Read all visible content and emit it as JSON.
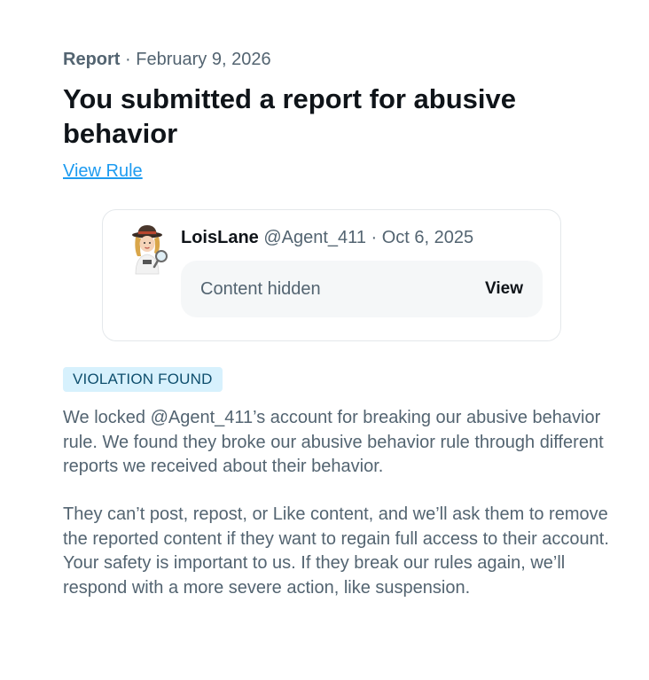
{
  "header": {
    "label": "Report",
    "separator": "·",
    "date": "February 9, 2026",
    "title": "You submitted a report for abusive behavior",
    "view_rule_link": "View Rule"
  },
  "reported_post": {
    "avatar_icon": "detective-avatar-icon",
    "author_name": "LoisLane",
    "author_handle": "@Agent_411",
    "separator": "·",
    "post_date": "Oct 6, 2025",
    "content_hidden_text": "Content hidden",
    "view_button": "View"
  },
  "status": {
    "badge": "VIOLATION FOUND",
    "badge_bg": "#d7f1fd",
    "badge_color": "#0e4e6d"
  },
  "body": {
    "paragraph_1": "We locked @Agent_411’s account for breaking our abusive behavior rule. We found they broke our abusive behavior rule through different reports we received about their behavior.",
    "paragraph_2": "They can’t post, repost, or Like content, and we’ll ask them to remove the reported content if they want to regain full access to their account. Your safety is important to us. If they break our rules again, we’ll respond with a more severe action, like suspension."
  },
  "colors": {
    "link": "#1d9bf0",
    "secondary_text": "#536471",
    "primary_text": "#0f1419"
  }
}
